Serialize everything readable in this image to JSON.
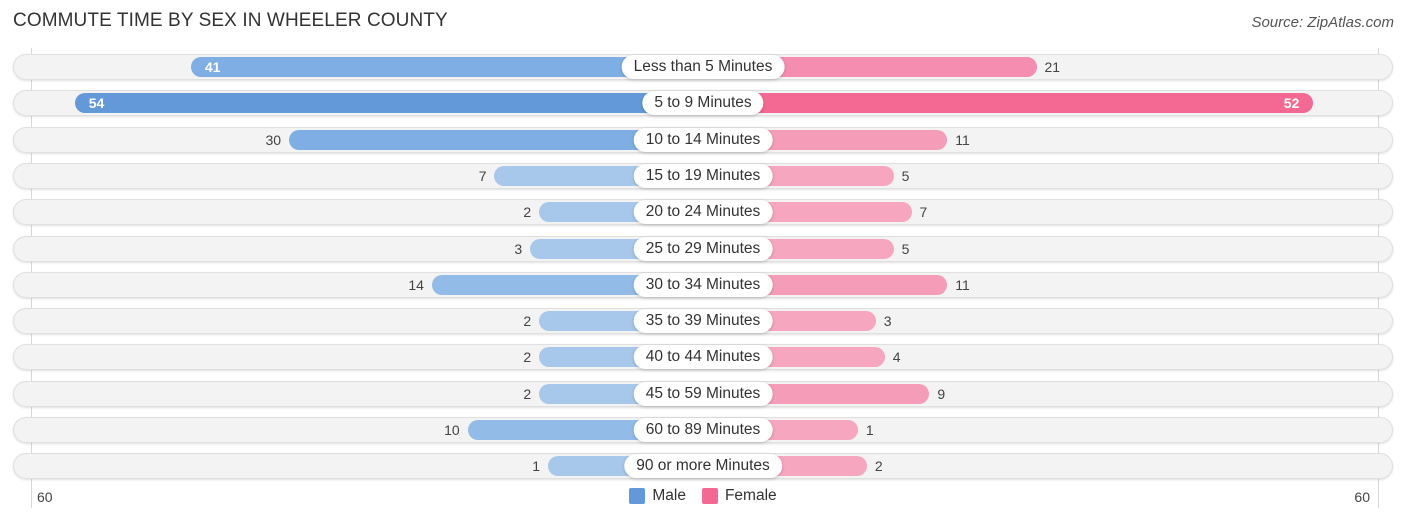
{
  "header": {
    "title": "COMMUTE TIME BY SEX IN WHEELER COUNTY",
    "source": "Source: ZipAtlas.com"
  },
  "colors": {
    "male_strong": "#6399d9",
    "male_light": "#a7c7eb",
    "female_strong": "#f46894",
    "female_light": "#f6a6bf"
  },
  "chart_data": {
    "type": "bar",
    "orientation": "horizontal-diverging",
    "title": "COMMUTE TIME BY SEX IN WHEELER COUNTY",
    "categories": [
      "Less than 5 Minutes",
      "5 to 9 Minutes",
      "10 to 14 Minutes",
      "15 to 19 Minutes",
      "20 to 24 Minutes",
      "25 to 29 Minutes",
      "30 to 34 Minutes",
      "35 to 39 Minutes",
      "40 to 44 Minutes",
      "45 to 59 Minutes",
      "60 to 89 Minutes",
      "90 or more Minutes"
    ],
    "series": [
      {
        "name": "Male",
        "side": "left",
        "values": [
          41,
          54,
          30,
          7,
          2,
          3,
          14,
          2,
          2,
          2,
          10,
          1
        ]
      },
      {
        "name": "Female",
        "side": "right",
        "values": [
          21,
          52,
          11,
          5,
          7,
          5,
          11,
          3,
          4,
          9,
          1,
          2
        ]
      }
    ],
    "axis": {
      "left_tick": "60",
      "right_tick": "60",
      "max": 60
    },
    "legend": {
      "position": "bottom-center",
      "items": [
        "Male",
        "Female"
      ]
    },
    "grid": false
  }
}
